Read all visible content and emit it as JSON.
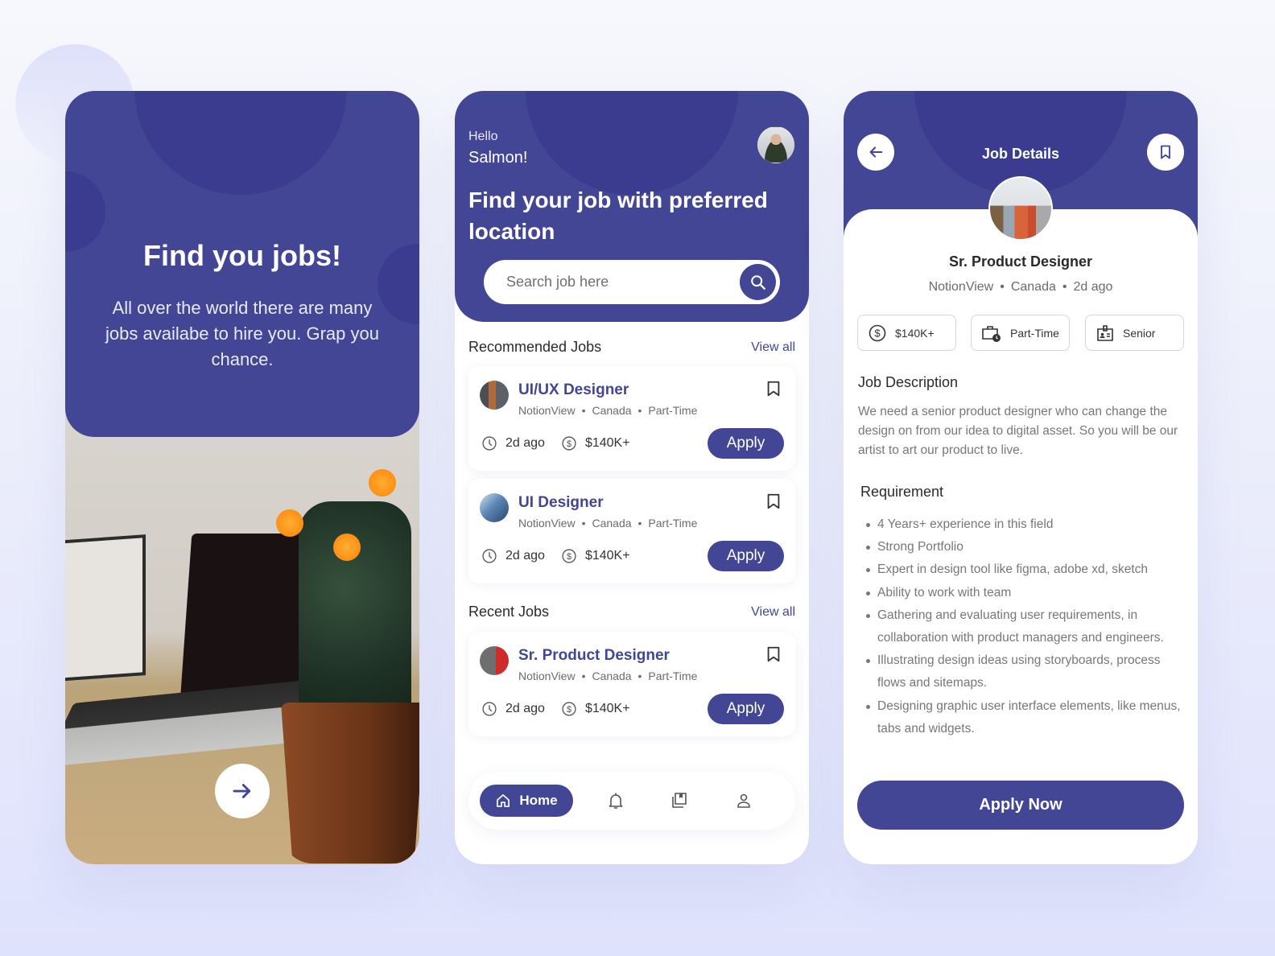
{
  "theme": {
    "primary": "#434595",
    "primary_dark": "#3b3b8f",
    "background": "#eef0fb"
  },
  "onboarding": {
    "title": "Find you jobs!",
    "description": "All over the world there are many jobs availabe to hire you. Grap you chance.",
    "next_icon": "arrow-right-icon"
  },
  "home": {
    "greeting": "Hello",
    "user_name": "Salmon!",
    "headline": "Find your job with preferred location",
    "search": {
      "placeholder": "Search job here",
      "value": "",
      "icon": "search-icon"
    },
    "recommended": {
      "title": "Recommended Jobs",
      "view_all": "View all",
      "jobs": [
        {
          "title": "UI/UX Designer",
          "company": "NotionView",
          "location": "Canada",
          "type": "Part-Time",
          "posted": "2d ago",
          "salary": "$140K+",
          "apply": "Apply"
        },
        {
          "title": "UI Designer",
          "company": "NotionView",
          "location": "Canada",
          "type": "Part-Time",
          "posted": "2d ago",
          "salary": "$140K+",
          "apply": "Apply"
        }
      ]
    },
    "recent": {
      "title": "Recent Jobs",
      "view_all": "View all",
      "jobs": [
        {
          "title": "Sr. Product Designer",
          "company": "NotionView",
          "location": "Canada",
          "type": "Part-Time",
          "posted": "2d ago",
          "salary": "$140K+",
          "apply": "Apply"
        }
      ]
    },
    "nav": {
      "home": "Home",
      "items": [
        "home-icon",
        "bell-icon",
        "saved-jobs-icon",
        "profile-icon"
      ],
      "active": "Home"
    }
  },
  "details": {
    "header_title": "Job Details",
    "job_title": "Sr. Product Designer",
    "company": "NotionView",
    "location": "Canada",
    "posted": "2d ago",
    "chips": [
      "$140K+",
      "Part-Time",
      "Senior"
    ],
    "description_title": "Job Description",
    "description": "We need a senior product designer who can change the design on from our idea to digital asset. So you will be our artist to art our product to live.",
    "requirement_title": "Requirement",
    "requirements": [
      "4 Years+ experience in this field",
      "Strong Portfolio",
      "Expert in design tool like figma, adobe xd, sketch",
      "Ability to work with team",
      "Gathering and evaluating user requirements, in collaboration with product managers and engineers.",
      "Illustrating design ideas using storyboards, process flows and sitemaps.",
      "Designing graphic user interface elements, like menus, tabs and widgets."
    ],
    "apply_label": "Apply Now"
  }
}
